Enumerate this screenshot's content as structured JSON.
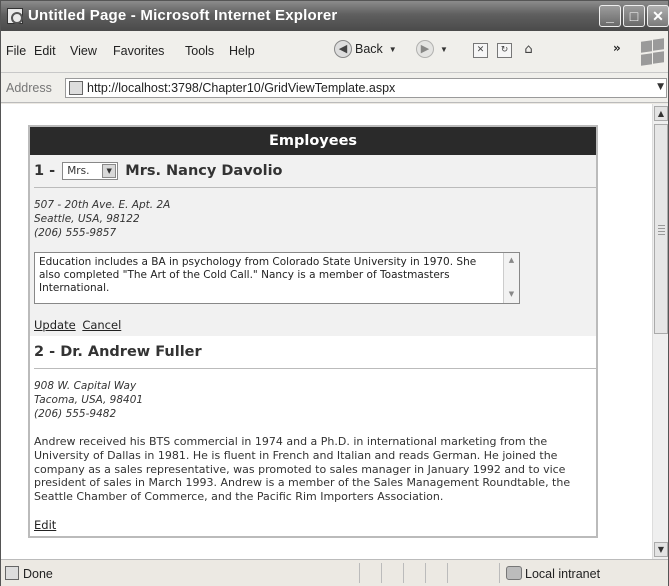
{
  "window": {
    "title": "Untitled Page - Microsoft Internet Explorer"
  },
  "menu": {
    "file": "File",
    "edit": "Edit",
    "view": "View",
    "favorites": "Favorites",
    "tools": "Tools",
    "help": "Help",
    "back_label": "Back"
  },
  "address": {
    "label": "Address",
    "url": "http://localhost:3798/Chapter10/GridViewTemplate.aspx"
  },
  "grid": {
    "header": "Employees",
    "rows": [
      {
        "number_prefix": "1 -",
        "title_select": "Mrs.",
        "name": "Mrs. Nancy Davolio",
        "address_line1": "507 - 20th Ave. E. Apt. 2A",
        "address_line2": "Seattle, USA, 98122",
        "phone": "(206) 555-9857",
        "notes": "Education includes a BA in psychology from Colorado State University in 1970.  She also completed \"The Art of the Cold Call.\"  Nancy is a member of Toastmasters International.",
        "update_label": "Update",
        "cancel_label": "Cancel"
      },
      {
        "title": "2 - Dr. Andrew Fuller",
        "address_line1": "908 W. Capital Way",
        "address_line2": "Tacoma, USA, 98401",
        "phone": "(206) 555-9482",
        "notes": "Andrew received his BTS commercial in 1974 and a Ph.D. in international marketing from the University of Dallas in 1981. He is fluent in French and Italian and reads German. He joined the company as a sales representative, was promoted to sales manager in January 1992 and to vice president of sales in March 1993. Andrew is a member of the Sales Management Roundtable, the Seattle Chamber of Commerce, and the Pacific Rim Importers Association.",
        "edit_label": "Edit"
      }
    ]
  },
  "status": {
    "text": "Done",
    "zone": "Local intranet"
  },
  "icons": {
    "app": "ie-page-icon",
    "back": "back-arrow-icon",
    "forward": "forward-arrow-icon",
    "stop": "stop-icon",
    "refresh": "refresh-icon",
    "home": "home-icon",
    "windows_logo": "windows-logo-icon"
  }
}
